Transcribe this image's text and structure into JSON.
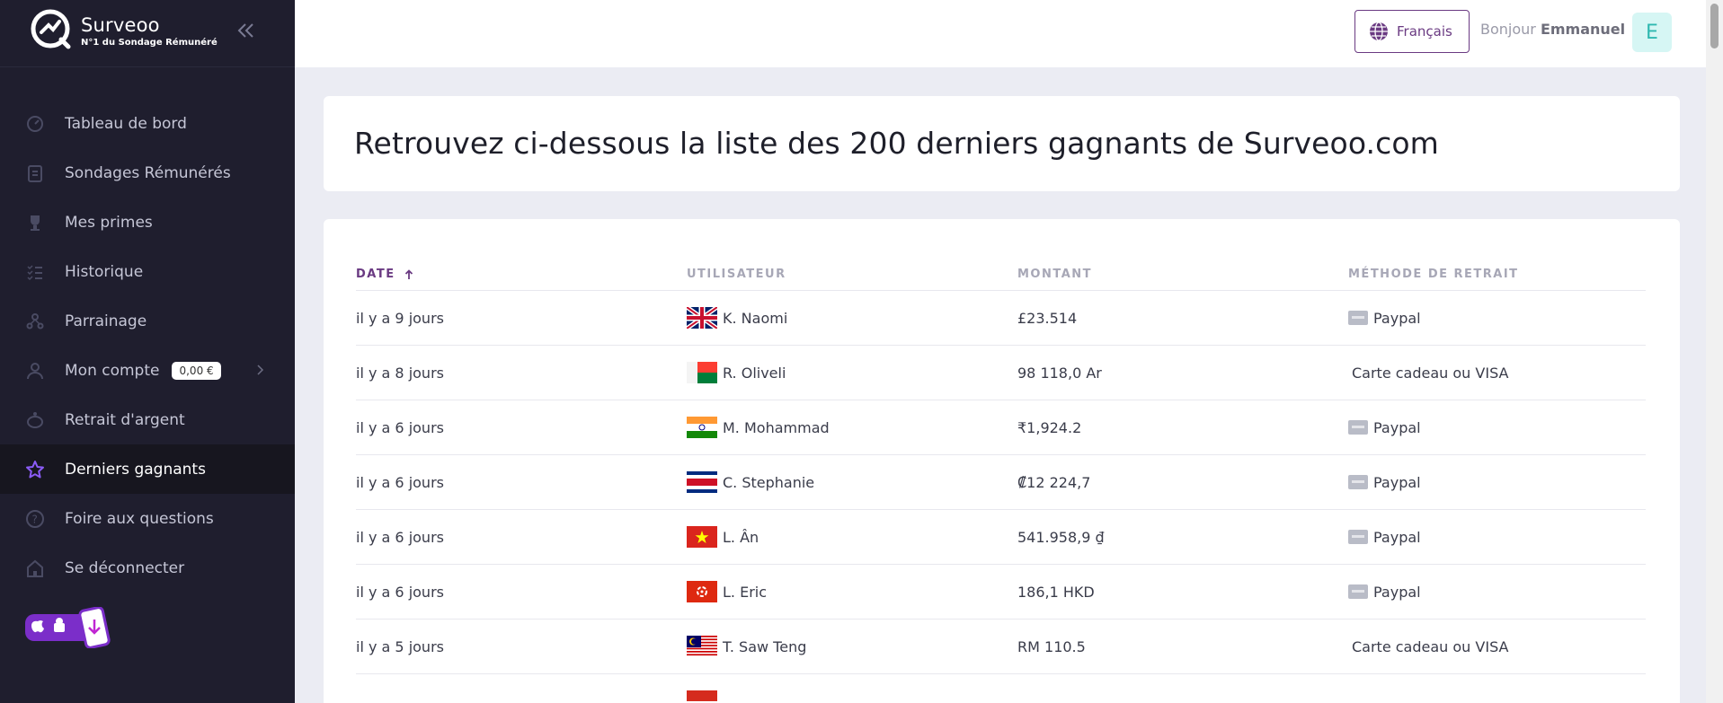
{
  "brand": {
    "name": "Surveoo",
    "tagline": "N°1 du Sondage Rémunéré"
  },
  "sidebar": {
    "items": [
      {
        "label": "Tableau de bord",
        "icon": "dashboard-icon"
      },
      {
        "label": "Sondages Rémunérés",
        "icon": "clipboard-icon"
      },
      {
        "label": "Mes primes",
        "icon": "trophy-icon"
      },
      {
        "label": "Historique",
        "icon": "list-check-icon"
      },
      {
        "label": "Parrainage",
        "icon": "referral-icon"
      },
      {
        "label": "Mon compte",
        "icon": "user-icon",
        "badge": "0,00 €"
      },
      {
        "label": "Retrait d'argent",
        "icon": "piggy-bank-icon"
      },
      {
        "label": "Derniers gagnants",
        "icon": "star-icon",
        "active": true
      },
      {
        "label": "Foire aux questions",
        "icon": "question-icon"
      },
      {
        "label": "Se déconnecter",
        "icon": "logout-icon"
      }
    ]
  },
  "header": {
    "language": "Français",
    "greeting": "Bonjour",
    "user_name": "Emmanuel",
    "avatar_letter": "E"
  },
  "page": {
    "title": "Retrouvez ci-dessous la liste des 200 derniers gagnants de Surveoo.com"
  },
  "table": {
    "columns": [
      "DATE",
      "UTILISATEUR",
      "MONTANT",
      "MÉTHODE DE RETRAIT"
    ],
    "rows": [
      {
        "date": "il y a 9 jours",
        "flag": "gb",
        "user": "K. Naomi",
        "amount": "£23.514",
        "method": "Paypal",
        "method_icon": true
      },
      {
        "date": "il y a 8 jours",
        "flag": "mg",
        "user": "R. Oliveli",
        "amount": "98 118,0 Ar",
        "method": "Carte cadeau ou VISA",
        "method_icon": false
      },
      {
        "date": "il y a 6 jours",
        "flag": "in",
        "user": "M. Mohammad",
        "amount": "₹1,924.2",
        "method": "Paypal",
        "method_icon": true
      },
      {
        "date": "il y a 6 jours",
        "flag": "cr",
        "user": "C. Stephanie",
        "amount": "₡12 224,7",
        "method": "Paypal",
        "method_icon": true
      },
      {
        "date": "il y a 6 jours",
        "flag": "vn",
        "user": "L. Ân",
        "amount": "541.958,9 ₫",
        "method": "Paypal",
        "method_icon": true
      },
      {
        "date": "il y a 6 jours",
        "flag": "hk",
        "user": "L. Eric",
        "amount": "186,1 HKD",
        "method": "Paypal",
        "method_icon": true
      },
      {
        "date": "il y a 5 jours",
        "flag": "my",
        "user": "T. Saw Teng",
        "amount": "RM 110.5",
        "method": "Carte cadeau ou VISA",
        "method_icon": false
      }
    ]
  },
  "colors": {
    "accent": "#6a3a82",
    "sidebar_bg": "#1f1e2e",
    "page_bg": "#ebecf3",
    "active_star": "#8b5cf6"
  }
}
